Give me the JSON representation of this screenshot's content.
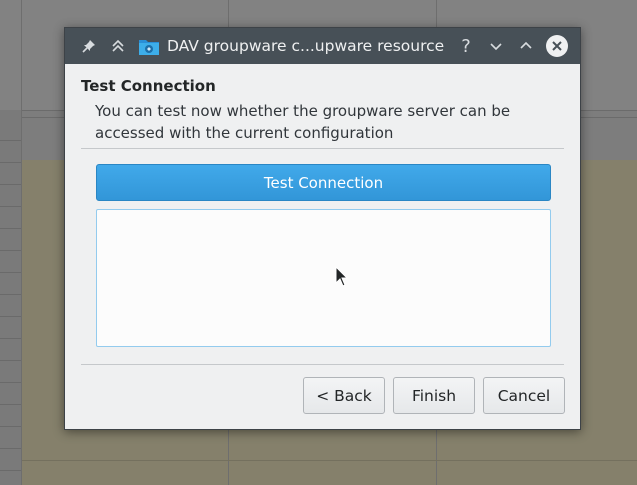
{
  "window": {
    "title": "DAV groupware c...upware resource",
    "icons": [
      "pin-icon",
      "keep-above-icon",
      "app-icon",
      "help-icon",
      "minimize-icon",
      "maximize-icon",
      "close-icon"
    ],
    "help_glyph": "?"
  },
  "page": {
    "title": "Test Connection",
    "subtitle": "You can test now whether the groupware server can be accessed with the current configuration"
  },
  "test_button": {
    "label": "Test Connection"
  },
  "output": {
    "text": ""
  },
  "buttons": {
    "back": "< Back",
    "finish": "Finish",
    "cancel": "Cancel"
  },
  "colors": {
    "titlebar": "#475057",
    "accent": "#3daee9",
    "dialog_bg": "#eff0f1"
  }
}
